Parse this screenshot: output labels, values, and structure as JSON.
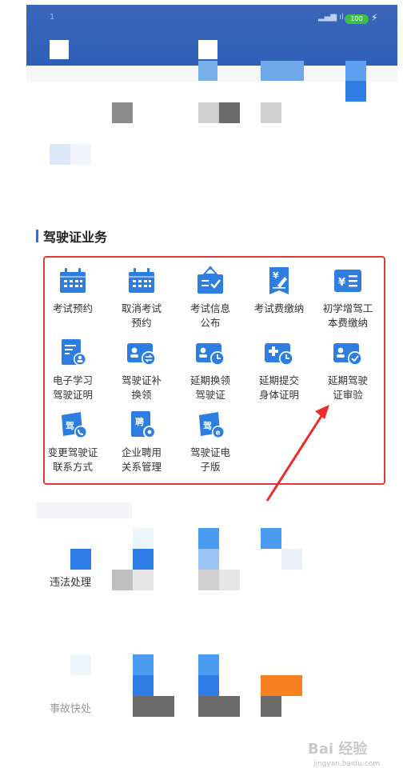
{
  "status": {
    "battery": "100"
  },
  "section": {
    "title": "驾驶证业务"
  },
  "services": [
    {
      "label": "考试预约",
      "icon": "calendar-icon"
    },
    {
      "label": "取消考试\n预约",
      "icon": "calendar-icon"
    },
    {
      "label": "考试信息\n公布",
      "icon": "notice-board-icon"
    },
    {
      "label": "考试费缴纳",
      "icon": "fee-document-icon"
    },
    {
      "label": "初学增驾工\n本费缴纳",
      "icon": "fee-list-icon"
    },
    {
      "label": "电子学习\n驾驶证明",
      "icon": "certificate-icon"
    },
    {
      "label": "驾驶证补\n换领",
      "icon": "license-exchange-icon"
    },
    {
      "label": "延期换领\n驾驶证",
      "icon": "license-clock-icon"
    },
    {
      "label": "延期提交\n身体证明",
      "icon": "medical-clock-icon"
    },
    {
      "label": "延期驾驶\n证审验",
      "icon": "license-check-icon"
    },
    {
      "label": "变更驾驶证\n联系方式",
      "icon": "license-phone-icon"
    },
    {
      "label": "企业聘用\n关系管理",
      "icon": "employment-icon"
    },
    {
      "label": "驾驶证电\n子版",
      "icon": "e-license-icon"
    }
  ],
  "lower": {
    "item1": "违法处理",
    "item2": "事故快处"
  },
  "watermark": {
    "brand": "Bai 经验",
    "url": "jingyan.baidu.com"
  },
  "colors": {
    "header": "#2e5fb8",
    "icon_blue": "#2e7de0",
    "highlight_red": "#e53935"
  }
}
